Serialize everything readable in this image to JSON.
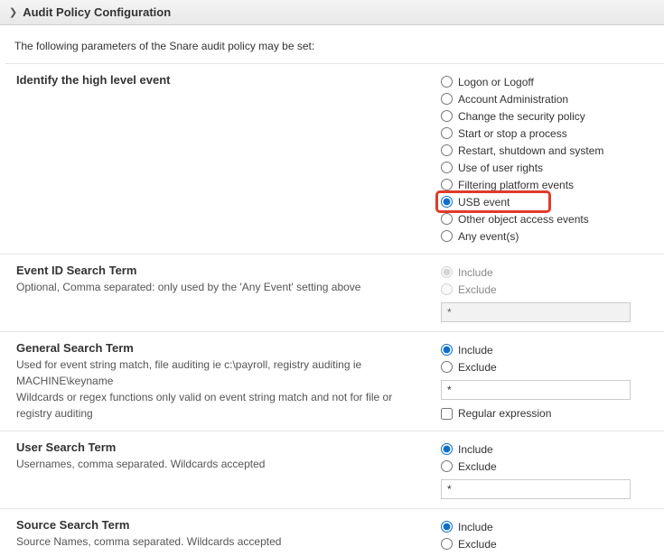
{
  "header": {
    "title": "Audit Policy Configuration"
  },
  "intro": "The following parameters of the Snare audit policy may be set:",
  "highlevel": {
    "label": "Identify the high level event",
    "options": [
      "Logon or Logoff",
      "Account Administration",
      "Change the security policy",
      "Start or stop a process",
      "Restart, shutdown and system",
      "Use of user rights",
      "Filtering platform events",
      "USB event",
      "Other object access events",
      "Any event(s)"
    ],
    "selected_index": 7
  },
  "eventid": {
    "label": "Event ID Search Term",
    "desc": "Optional, Comma separated: only used by the 'Any Event' setting above",
    "include": "Include",
    "exclude": "Exclude",
    "value": "*"
  },
  "general": {
    "label": "General Search Term",
    "desc1": "Used for event string match, file auditing ie c:\\payroll, registry auditing ie MACHINE\\keyname",
    "desc2": "Wildcards or regex functions only valid on event string match and not for file or registry auditing",
    "include": "Include",
    "exclude": "Exclude",
    "value": "*",
    "regex_label": "Regular expression"
  },
  "user": {
    "label": "User Search Term",
    "desc": "Usernames, comma separated. Wildcards accepted",
    "include": "Include",
    "exclude": "Exclude",
    "value": "*"
  },
  "source": {
    "label": "Source Search Term",
    "desc": "Source Names, comma separated. Wildcards accepted",
    "include": "Include",
    "exclude": "Exclude"
  }
}
